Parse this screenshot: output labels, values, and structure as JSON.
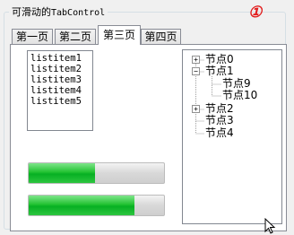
{
  "group": {
    "title_cn": "可滑动的",
    "title_en": "TabControl",
    "marker": "①"
  },
  "tabs": [
    {
      "label": "第一页"
    },
    {
      "label": "第二页"
    },
    {
      "label": "第三页"
    },
    {
      "label": "第四页"
    }
  ],
  "active_tab": "第三页",
  "listbox": {
    "items": [
      "listitem1",
      "listitem2",
      "listitem3",
      "listitem4",
      "listitem5"
    ]
  },
  "progress_bars": [
    {
      "value_percent": 49
    },
    {
      "value_percent": 78
    }
  ],
  "tree": {
    "nodes": [
      {
        "label": "节点0",
        "expanded": false
      },
      {
        "label": "节点1",
        "expanded": true,
        "children": [
          {
            "label": "节点9"
          },
          {
            "label": "节点10"
          }
        ]
      },
      {
        "label": "节点2",
        "expanded": false
      },
      {
        "label": "节点3"
      },
      {
        "label": "节点4"
      }
    ]
  },
  "colors": {
    "progress_fill": "#06b023",
    "marker": "#e21c1c",
    "group_border": "#d5dfe5",
    "tab_border": "#898c95"
  }
}
